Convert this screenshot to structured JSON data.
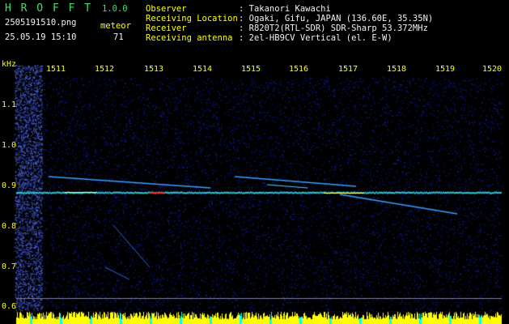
{
  "app": {
    "name": "H R O F F T",
    "version": "1.0.0"
  },
  "file": {
    "name": "2505191510.png",
    "datetime": "25.05.19 15:10"
  },
  "meteor": {
    "label": "meteor",
    "count": "71"
  },
  "info": {
    "observer_label": "Observer",
    "observer": ": Takanori Kawachi",
    "location_label": "Receiving Location",
    "location": ": Ogaki, Gifu, JAPAN (136.60E, 35.35N)",
    "receiver_label": "Receiver",
    "receiver": ": R820T2(RTL-SDR) SDR-Sharp 53.372MHz",
    "antenna_label": "Receiving antenna",
    "antenna": ": 2el-HB9CV Vertical (el. E-W)"
  },
  "yaxis": {
    "unit": "kHz",
    "ticks": [
      "1.1",
      "1.0",
      "0.9",
      "0.8",
      "0.7",
      "0.6"
    ]
  },
  "xaxis": {
    "ticks": [
      "1511",
      "1512",
      "1513",
      "1514",
      "1515",
      "1516",
      "1517",
      "1518",
      "1519",
      "1520"
    ]
  },
  "colors": {
    "background": "#000000",
    "spectrum_noise": "#0b1c8a",
    "carrier_line": "#2fd0e0",
    "hot_spot": "#ff3030",
    "meteor_echo": "#3aa0ff",
    "axis_text": "#ffff00",
    "title_text": "#3fe06a",
    "bottom_bar": "#ffff00",
    "bottom_bar_alt": "#00ffff"
  }
}
